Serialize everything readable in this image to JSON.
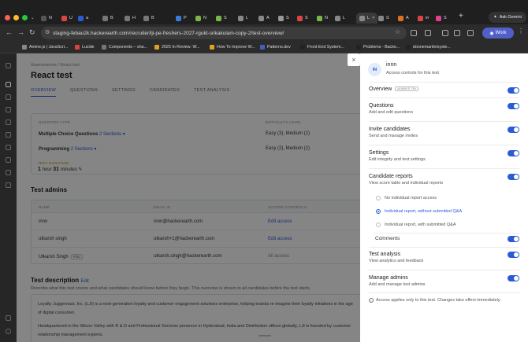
{
  "browser": {
    "tabs": [
      {
        "label": "N",
        "color": "#555"
      },
      {
        "label": "U",
        "color": "#d44"
      },
      {
        "label": "a",
        "color": "#2a5bd7"
      },
      {
        "label": "B",
        "color": "#777"
      },
      {
        "label": "H",
        "color": "#777"
      },
      {
        "label": "B",
        "color": "#777"
      },
      {
        "label": "P",
        "color": "#3a7bd5"
      },
      {
        "label": "N",
        "color": "#7ab648"
      },
      {
        "label": "S",
        "color": "#7ab648"
      },
      {
        "label": "L",
        "color": "#888"
      },
      {
        "label": "A",
        "color": "#888"
      },
      {
        "label": "S",
        "color": "#999"
      },
      {
        "label": "S",
        "color": "#d44"
      },
      {
        "label": "N",
        "color": "#7ab648"
      },
      {
        "label": "L",
        "color": "#888"
      },
      {
        "label": "S",
        "color": "#888"
      },
      {
        "label": "A",
        "color": "#e07020"
      },
      {
        "label": "in",
        "color": "#d44"
      },
      {
        "label": "S",
        "color": "#e04090"
      }
    ],
    "active_tab": "L",
    "new_tab_label": "+",
    "ask_gemini": "Ask Gemini",
    "url": "staging-febau2k.hackerearth.com/recruiter/lji-pe-freshers-2027-rgukt-srikakulam-copy-2/test-overview/",
    "profile_label": "Work",
    "bookmarks": [
      {
        "label": "Anime.js | JavaScri...",
        "color": "#888"
      },
      {
        "label": "Lucide",
        "color": "#e04040"
      },
      {
        "label": "Components – sha...",
        "color": "#777"
      },
      {
        "label": "2025 In Review: W...",
        "color": "#e0a020"
      },
      {
        "label": "How To Improve W...",
        "color": "#e0a020"
      },
      {
        "label": "Patterns.dev",
        "color": "#4060c0"
      },
      {
        "label": "Front End System...",
        "color": "#222"
      },
      {
        "label": "Problems - Backe...",
        "color": "#222"
      },
      {
        "label": "donnemartin/syste...",
        "color": "#222"
      }
    ]
  },
  "page": {
    "breadcrumb": "Assessments  /  React test",
    "title": "React test",
    "tabs": [
      "OVERVIEW",
      "QUESTIONS",
      "SETTINGS",
      "CANDIDATES",
      "TEST ANALYSIS"
    ],
    "questions_card": {
      "col_type": "QUESTION TYPE",
      "col_difficulty": "DIFFICULTY LEVEL",
      "rows": [
        {
          "type": "Multiple Choice Questions",
          "sections": "2 Sections",
          "difficulty": "Easy (3), Medium (2)"
        },
        {
          "type": "Programming",
          "sections": "2 Sections",
          "difficulty": "Easy (2), Medium (2)"
        }
      ],
      "duration_label": "TEST DURATION",
      "duration_hours": "1",
      "duration_hours_unit": "hour",
      "duration_minutes": "31",
      "duration_minutes_unit": "minutes"
    },
    "admins_title": "Test admins",
    "admins_cols": {
      "name": "NAME",
      "email": "EMAIL ID",
      "access": "ACCESS CONTROLS"
    },
    "admins": [
      {
        "name": "innn",
        "email": "innn@hackerearth.com",
        "access": "Edit access",
        "poc": ""
      },
      {
        "name": "utkarsh singh",
        "email": "utkarsh+1@hackerearth.com",
        "access": "Edit access",
        "poc": ""
      },
      {
        "name": "Utkarsh Singh",
        "email": "utkarsh.singh@hackerearth.com",
        "access": "All access",
        "poc": "POC"
      }
    ],
    "description_title": "Test description",
    "description_edit": "Edit",
    "description_hint": "Describe what this test covers and what candidates should know before they begin. This overview is shown to all candidates before the test starts.",
    "description_body": [
      "Loyalty Juggernaut, Inc. (LJI) is a next-generation loyalty and customer engagement solutions enterprise, helping brands re-imagine their loyalty initiatives in the age of digital consumer.",
      "Headquartered in the Silicon Valley with R & D and Professional Services presence in Hyderabad, India and Distribution offices globally, LJI is founded by customer relationship management experts."
    ]
  },
  "panel": {
    "avatar_initials": "IN",
    "name": "innn",
    "subtitle": "Access controls for this test",
    "close_icon": "×",
    "items": [
      {
        "title": "Overview",
        "badge": "ALWAYS ON",
        "desc": ""
      },
      {
        "title": "Questions",
        "badge": "",
        "desc": "Add and edit questions"
      },
      {
        "title": "Invite candidates",
        "badge": "",
        "desc": "Send and manage invites"
      },
      {
        "title": "Settings",
        "badge": "",
        "desc": "Edit integrity and test settings"
      },
      {
        "title": "Candidate reports",
        "badge": "",
        "desc": "View score table and individual reports"
      },
      {
        "title": "Test analysis",
        "badge": "",
        "desc": "View analytics and feedback"
      },
      {
        "title": "Manage admins",
        "badge": "",
        "desc": "Add and manage test admins"
      }
    ],
    "report_options": [
      "No individual report access",
      "Individual report, without submitted Q&A",
      "Individual report, with submitted Q&A"
    ],
    "report_selected": 1,
    "comments_label": "Comments",
    "note": "Access applies only to this test. Changes take effect immediately.",
    "accent": "#2a5bd7"
  }
}
